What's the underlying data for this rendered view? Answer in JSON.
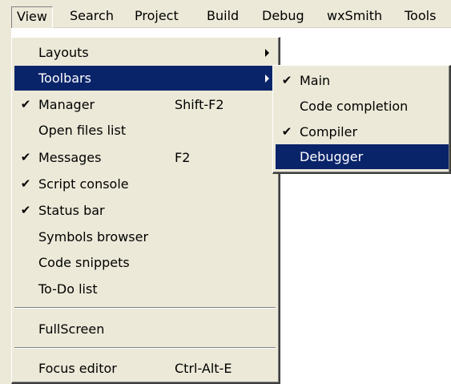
{
  "menubar": {
    "items": [
      "View",
      "Search",
      "Project",
      "Build",
      "Debug",
      "wxSmith",
      "Tools"
    ]
  },
  "view_menu": {
    "items": [
      {
        "label": "Layouts",
        "checked": false,
        "shortcut": "",
        "submenu": true
      },
      {
        "label": "Toolbars",
        "checked": false,
        "shortcut": "",
        "submenu": true,
        "highlighted": true
      },
      {
        "label": "Manager",
        "checked": true,
        "shortcut": "Shift-F2",
        "submenu": false
      },
      {
        "label": "Open files list",
        "checked": false,
        "shortcut": "",
        "submenu": false
      },
      {
        "label": "Messages",
        "checked": true,
        "shortcut": "F2",
        "submenu": false
      },
      {
        "label": "Script console",
        "checked": true,
        "shortcut": "",
        "submenu": false
      },
      {
        "label": "Status bar",
        "checked": true,
        "shortcut": "",
        "submenu": false
      },
      {
        "label": "Symbols browser",
        "checked": false,
        "shortcut": "",
        "submenu": false
      },
      {
        "label": "Code snippets",
        "checked": false,
        "shortcut": "",
        "submenu": false
      },
      {
        "label": "To-Do list",
        "checked": false,
        "shortcut": "",
        "submenu": false
      },
      {
        "label": "FullScreen",
        "checked": false,
        "shortcut": "",
        "submenu": false
      },
      {
        "label": "Focus editor",
        "checked": false,
        "shortcut": "Ctrl-Alt-E",
        "submenu": false
      }
    ]
  },
  "toolbars_menu": {
    "items": [
      {
        "label": "Main",
        "checked": true
      },
      {
        "label": "Code completion",
        "checked": false
      },
      {
        "label": "Compiler",
        "checked": true
      },
      {
        "label": "Debugger",
        "checked": false,
        "highlighted": true
      }
    ]
  },
  "glyphs": {
    "check": "✔"
  },
  "colors": {
    "menu_bg": "#ece9d8",
    "highlight_bg": "#0a246a",
    "highlight_fg": "#ffffff"
  }
}
